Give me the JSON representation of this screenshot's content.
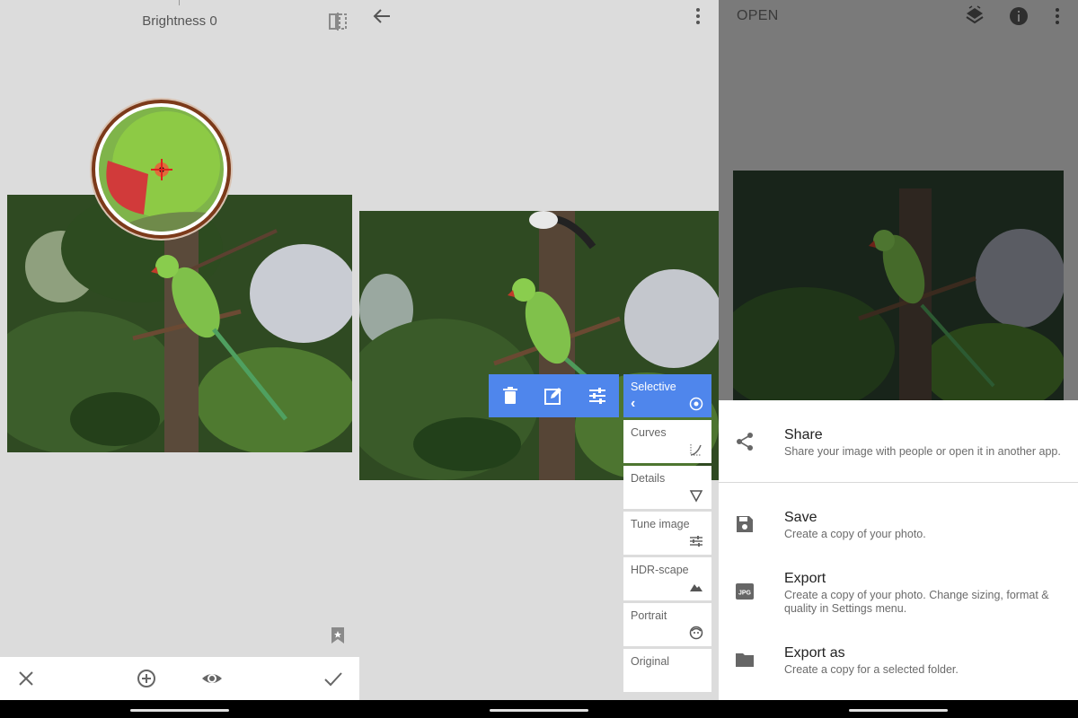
{
  "panel1": {
    "title": "Brightness 0",
    "icons": [
      "compare-icon",
      "bookmark-icon",
      "close-icon",
      "add-circle-icon",
      "eye-icon",
      "check-icon"
    ]
  },
  "panel2": {
    "tools": [
      {
        "label": "Selective",
        "icon": "target-icon",
        "selected": true
      },
      {
        "label": "Curves",
        "icon": "curves-icon"
      },
      {
        "label": "Details",
        "icon": "triangle-icon"
      },
      {
        "label": "Tune image",
        "icon": "sliders-icon"
      },
      {
        "label": "HDR-scape",
        "icon": "mountains-icon"
      },
      {
        "label": "Portrait",
        "icon": "face-icon"
      },
      {
        "label": "Original",
        "icon": ""
      }
    ],
    "selective_back": "‹"
  },
  "panel3": {
    "open_label": "OPEN",
    "sheet": [
      {
        "title": "Share",
        "desc": "Share your image with people or open it in another app.",
        "icon": "share-icon"
      },
      {
        "title": "Save",
        "desc": "Create a copy of your photo.",
        "icon": "save-icon"
      },
      {
        "title": "Export",
        "desc": "Create a copy of your photo. Change sizing, format & quality in Settings menu.",
        "icon": "jpg-icon"
      },
      {
        "title": "Export as",
        "desc": "Create a copy for a selected folder.",
        "icon": "folder-icon"
      }
    ],
    "jpg_badge": "JPG"
  },
  "colors": {
    "accent": "#4f86ec",
    "panel_bg": "#dcdcdc",
    "loupe_ring": "#7c3a1a"
  }
}
